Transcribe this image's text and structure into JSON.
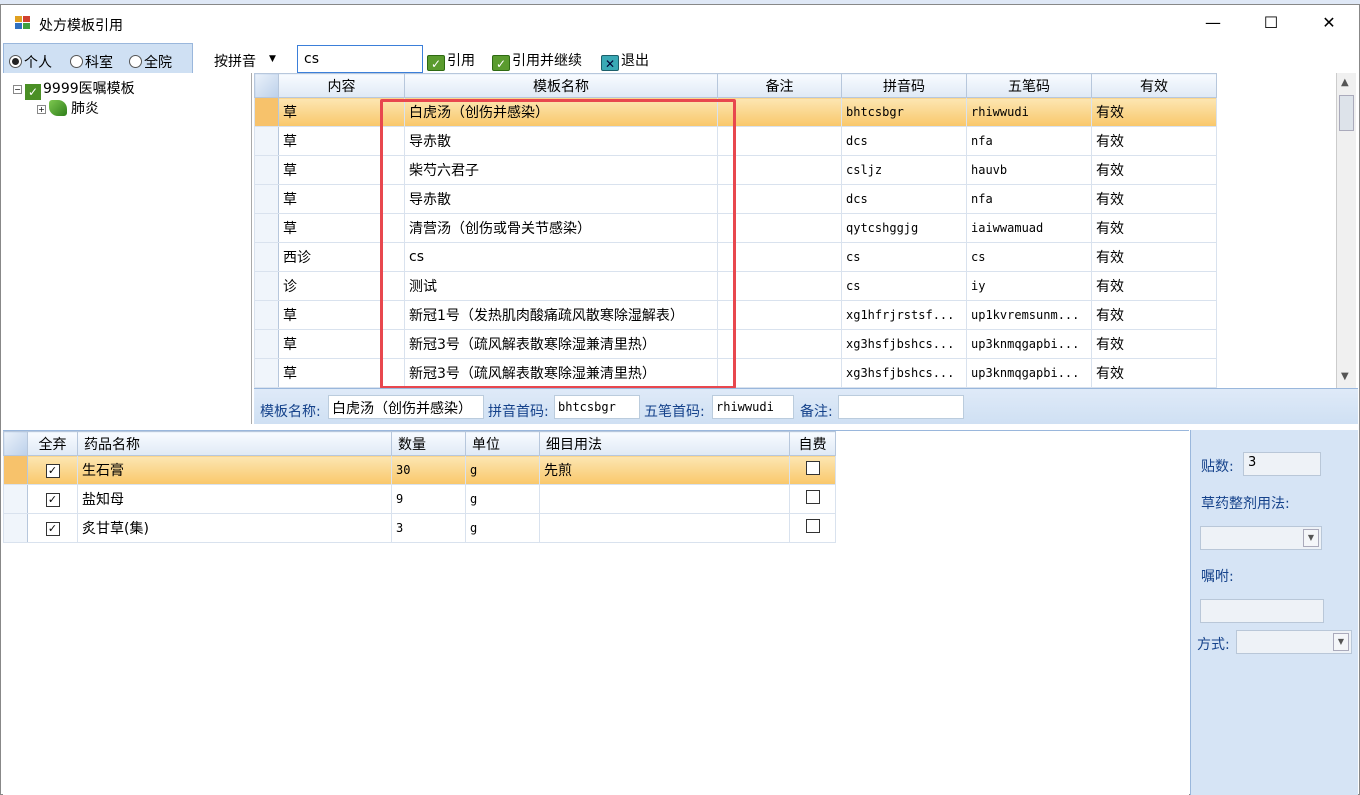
{
  "window": {
    "title": "处方模板引用"
  },
  "scope": {
    "options": [
      "个人",
      "科室",
      "全院"
    ],
    "selected": "个人"
  },
  "search": {
    "mode": "按拼音",
    "query": "cs"
  },
  "buttons": {
    "apply": "引用",
    "apply_continue": "引用并继续",
    "exit": "退出"
  },
  "tree": {
    "root": "9999医嘱模板",
    "child": "肺炎"
  },
  "template_table": {
    "columns": [
      "内容",
      "模板名称",
      "备注",
      "拼音码",
      "五笔码",
      "有效"
    ],
    "rows": [
      {
        "content": "草",
        "name": "白虎汤（创伤并感染）",
        "remark": "",
        "pinyin": "bhtcsbgr",
        "wubi": "rhiwwudi",
        "valid": "有效"
      },
      {
        "content": "草",
        "name": "导赤散",
        "remark": "",
        "pinyin": "dcs",
        "wubi": "nfa",
        "valid": "有效"
      },
      {
        "content": "草",
        "name": "柴芍六君子",
        "remark": "",
        "pinyin": "csljz",
        "wubi": "hauvb",
        "valid": "有效"
      },
      {
        "content": "草",
        "name": "导赤散",
        "remark": "",
        "pinyin": "dcs",
        "wubi": "nfa",
        "valid": "有效"
      },
      {
        "content": "草",
        "name": "清营汤（创伤或骨关节感染）",
        "remark": "",
        "pinyin": "qytcshggjg",
        "wubi": "iaiwwamuad",
        "valid": "有效"
      },
      {
        "content": "西诊",
        "name": "cs",
        "remark": "",
        "pinyin": "cs",
        "wubi": "cs",
        "valid": "有效"
      },
      {
        "content": "诊",
        "name": "测试",
        "remark": "",
        "pinyin": "cs",
        "wubi": "iy",
        "valid": "有效"
      },
      {
        "content": "草",
        "name": "新冠1号（发热肌肉酸痛疏风散寒除湿解表）",
        "remark": "",
        "pinyin": "xg1hfrjrstsf...",
        "wubi": "up1kvremsunm...",
        "valid": "有效"
      },
      {
        "content": "草",
        "name": "新冠3号（疏风解表散寒除湿兼清里热）",
        "remark": "",
        "pinyin": "xg3hsfjbshcs...",
        "wubi": "up3knmqgapbi...",
        "valid": "有效"
      },
      {
        "content": "草",
        "name": "新冠3号（疏风解表散寒除湿兼清里热）",
        "remark": "",
        "pinyin": "xg3hsfjbshcs...",
        "wubi": "up3knmqgapbi...",
        "valid": "有效"
      }
    ]
  },
  "info": {
    "name_label": "模板名称:",
    "name_value": "白虎汤（创伤并感染）",
    "pinyin_label": "拼音首码:",
    "pinyin_value": "bhtcsbgr",
    "wubi_label": "五笔首码:",
    "wubi_value": "rhiwwudi",
    "remark_label": "备注:",
    "remark_value": ""
  },
  "drug_table": {
    "columns": [
      "全弃",
      "药品名称",
      "数量",
      "单位",
      "细目用法",
      "自费"
    ],
    "rows": [
      {
        "checked": true,
        "name": "生石膏",
        "qty": "30",
        "unit": "g",
        "usage": "先煎",
        "self_pay": false
      },
      {
        "checked": true,
        "name": "盐知母",
        "qty": "9",
        "unit": "g",
        "usage": "",
        "self_pay": false
      },
      {
        "checked": true,
        "name": "炙甘草(集)",
        "qty": "3",
        "unit": "g",
        "usage": "",
        "self_pay": false
      }
    ]
  },
  "side": {
    "dose_label": "贴数:",
    "dose_value": "3",
    "usage_label": "草药整剂用法:",
    "usage_value": "",
    "advice_label": "嘱咐:",
    "advice_value": "",
    "method_label": "方式:",
    "method_value": ""
  },
  "colors": {
    "active_row": "#f9c76a",
    "highlight_box": "#e8474e",
    "panel_blue": "#d6e4f5"
  }
}
